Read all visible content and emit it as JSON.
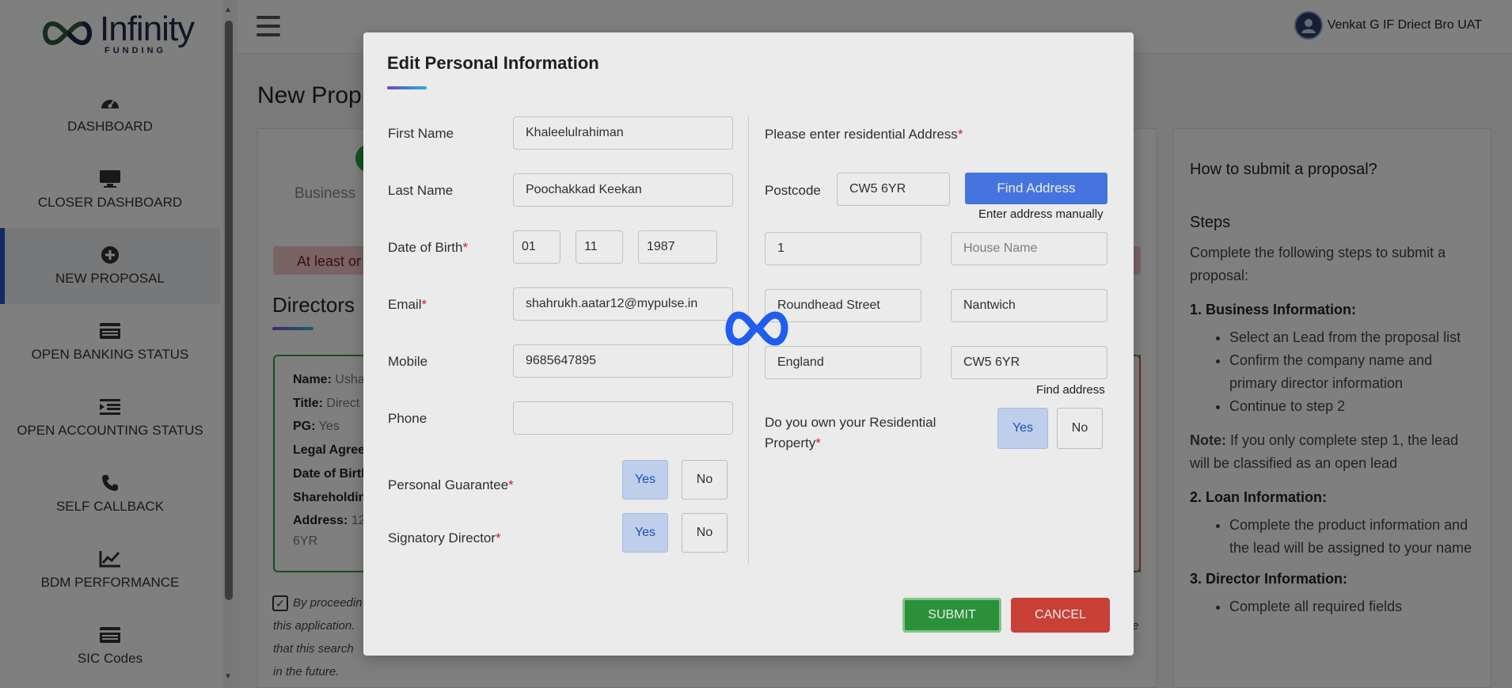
{
  "app": {
    "logo_main": "Infinity",
    "logo_sub": "FUNDING",
    "user_name": "Venkat G IF Driect Bro UAT"
  },
  "sidebar": {
    "items": [
      {
        "label": "DASHBOARD",
        "icon": "dashboard-icon"
      },
      {
        "label": "CLOSER DASHBOARD",
        "icon": "monitor-icon"
      },
      {
        "label": "NEW PROPOSAL",
        "icon": "plus-circle-icon",
        "active": true
      },
      {
        "label": "OPEN BANKING STATUS",
        "icon": "card-icon"
      },
      {
        "label": "OPEN ACCOUNTING STATUS",
        "icon": "indent-icon"
      },
      {
        "label": "SELF CALLBACK",
        "icon": "phone-icon"
      },
      {
        "label": "BDM PERFORMANCE",
        "icon": "chart-line-icon"
      },
      {
        "label": "SIC Codes",
        "icon": "card-icon"
      }
    ]
  },
  "background": {
    "page_title": "New Prop",
    "step_label": "Business",
    "warning": "At least or",
    "directors_title": "Directors",
    "director": {
      "name_label": "Name:",
      "name_value": "Usha",
      "title_label": "Title:",
      "title_value": "Direct",
      "pg_label": "PG:",
      "pg_value": "Yes",
      "legal_label": "Legal Agree",
      "dob_label": "Date of Birth",
      "share_label": "Shareholdin",
      "address_label": "Address:",
      "address_value": "12",
      "address_cont": "6YR"
    },
    "consent": [
      "By proceedin",
      "this application.",
      "that this search",
      "in the future."
    ],
    "consent_right_fragment": "e"
  },
  "help": {
    "title": "How to submit a proposal?",
    "steps_heading": "Steps",
    "intro": "Complete the following steps to submit a proposal:",
    "s1_heading": "1. Business Information:",
    "s1_items": [
      "Select an Lead from the proposal list",
      "Confirm the company name and primary director information",
      "Continue to step 2"
    ],
    "note_label": "Note:",
    "note_text": " If you only complete step 1, the lead will be classified as an open lead",
    "s2_heading": "2. Loan Information:",
    "s2_items": [
      "Complete the product information and the lead will be assigned to your name"
    ],
    "s3_heading": "3. Director Information:",
    "s3_items": [
      "Complete all required fields"
    ]
  },
  "modal": {
    "title": "Edit Personal Information",
    "first_name_label": "First Name",
    "first_name": "Khaleelulrahiman",
    "last_name_label": "Last Name",
    "last_name": "Poochakkad Keekan",
    "dob_label": "Date of Birth",
    "dob_day": "01",
    "dob_month": "11",
    "dob_year": "1987",
    "email_label": "Email",
    "email": "shahrukh.aatar12@mypulse.in",
    "mobile_label": "Mobile",
    "mobile": "9685647895",
    "phone_label": "Phone",
    "phone": "",
    "pg_label": "Personal Guarantee",
    "signatory_label": "Signatory Director",
    "yes": "Yes",
    "no": "No",
    "address_prompt": "Please enter residential Address",
    "postcode_label": "Postcode",
    "postcode": "CW5 6YR",
    "find_address_btn": "Find Address",
    "enter_manually": "Enter address manually",
    "house_number": "1",
    "house_name_placeholder": "House Name",
    "street": "Roundhead Street",
    "town": "Nantwich",
    "country": "England",
    "postcode2": "CW5 6YR",
    "find_address_link": "Find address",
    "own_property_label_1": "Do you own your Residential",
    "own_property_label_2": "Property",
    "required_mark": "*",
    "submit": "SUBMIT",
    "cancel": "CANCEL"
  },
  "colors": {
    "accent": "#1f55c9",
    "success": "#2e9e3e",
    "danger": "#d9463b",
    "find_button": "#4d7ef2",
    "selected_toggle": "#cfe0ff"
  }
}
